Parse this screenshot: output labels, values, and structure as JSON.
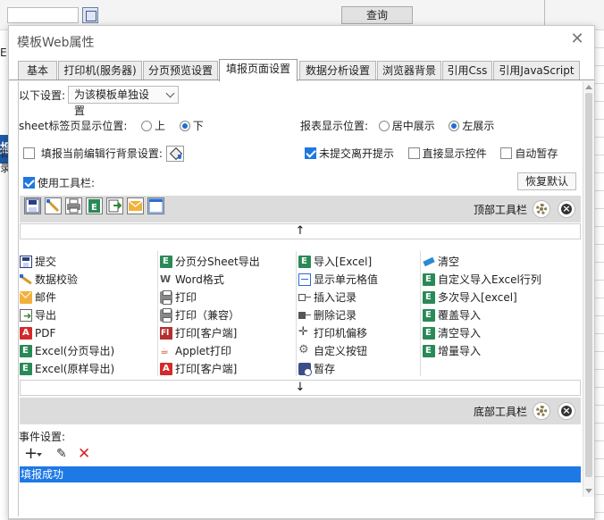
{
  "background": {
    "query_button": "查询",
    "left_strip_text": "报",
    "left_row_1": "E",
    "left_row_2": "目录"
  },
  "dialog": {
    "title": "模板Web属性",
    "tabs": [
      {
        "label": "基本"
      },
      {
        "label": "打印机(服务器)"
      },
      {
        "label": "分页预览设置"
      },
      {
        "label": "填报页面设置"
      },
      {
        "label": "数据分析设置"
      },
      {
        "label": "浏览器背景"
      },
      {
        "label": "引用Css"
      },
      {
        "label": "引用JavaScript"
      }
    ],
    "active_tab": "填报页面设置"
  },
  "settings": {
    "scope_label": "以下设置:",
    "scope_value": "为该模板单独设置",
    "sheet_pos_label": "sheet标签页显示位置:",
    "sheet_pos_options": [
      "上",
      "下"
    ],
    "sheet_pos_selected": "下",
    "report_pos_label": "报表显示位置:",
    "report_pos_options": [
      "居中展示",
      "左展示"
    ],
    "report_pos_selected": "左展示",
    "bg_label": "填报当前编辑行背景设置:",
    "unsubmitted_label": "未提交离开提示",
    "unsubmitted_checked": true,
    "direct_show_label": "直接显示控件",
    "direct_show_checked": false,
    "autosave_label": "自动暂存",
    "autosave_checked": false,
    "use_toolbar_label": "使用工具栏:",
    "use_toolbar_checked": true,
    "restore_button": "恢复默认"
  },
  "toolbar": {
    "top_label": "顶部工具栏",
    "bottom_label": "底部工具栏",
    "up_arrow": "↑",
    "down_arrow": "↓",
    "top_icons": [
      "save-icon",
      "pen-icon",
      "print-icon",
      "excel-icon",
      "export-icon",
      "mail-icon",
      "window-icon"
    ]
  },
  "buttons": {
    "col1": [
      "提交",
      "数据校验",
      "邮件",
      "导出",
      "PDF",
      "Excel(分页导出)",
      "Excel(原样导出)"
    ],
    "col2": [
      "分页分Sheet导出",
      "Word格式",
      "打印",
      "打印（兼容）",
      "打印[客户端]",
      "Applet打印",
      "打印[客户端]"
    ],
    "col3": [
      "导入[Excel]",
      "显示单元格值",
      "插入记录",
      "删除记录",
      "打印机偏移",
      "自定义按钮",
      "暂存"
    ],
    "col4": [
      "清空",
      "自定义导入Excel行列",
      "多次导入[excel]",
      "覆盖导入",
      "清空导入",
      "增量导入",
      ""
    ]
  },
  "events": {
    "label": "事件设置:",
    "add_symbol": "+",
    "items": [
      "填报成功"
    ]
  },
  "colors": {
    "accent": "#1e78e6",
    "toolbar_bg": "#dcdcdc",
    "delete_red": "#d22222"
  }
}
